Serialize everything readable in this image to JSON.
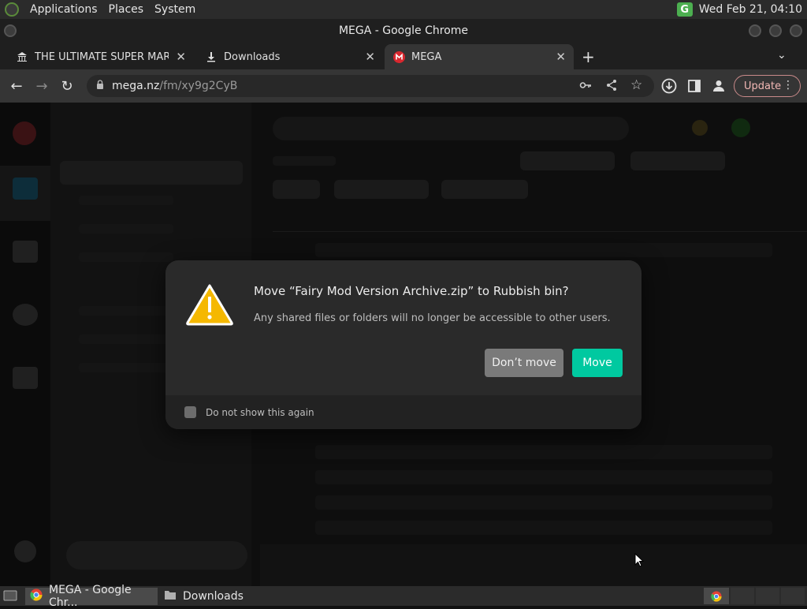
{
  "top_panel": {
    "menus": [
      "Applications",
      "Places",
      "System"
    ],
    "clock": "Wed Feb 21, 04:10",
    "badge": "G"
  },
  "window": {
    "title": "MEGA - Google Chrome"
  },
  "tabs": [
    {
      "label": "THE ULTIMATE SUPER MARIO",
      "icon": "museum-icon"
    },
    {
      "label": "Downloads",
      "icon": "download-icon"
    },
    {
      "label": "MEGA",
      "icon": "mega-logo-icon",
      "active": true
    }
  ],
  "address_bar": {
    "domain": "mega.nz",
    "path": "/fm/xy9g2CyB",
    "update_label": "Update"
  },
  "dialog": {
    "title": "Move “Fairy Mod Version Archive.zip” to Rubbish bin?",
    "message": "Any shared files or folders will no longer be accessible to other users.",
    "cancel_label": "Don’t move",
    "confirm_label": "Move",
    "checkbox_label": "Do not show this again",
    "checkbox_checked": false
  },
  "taskbar": {
    "items": [
      {
        "label": "MEGA - Google Chr...",
        "icon": "chrome-icon",
        "active": true
      },
      {
        "label": "Downloads",
        "icon": "folder-icon",
        "active": false
      }
    ]
  },
  "colors": {
    "accent": "#00c9a0",
    "warning": "#f5b800",
    "update_border": "#c98a8a"
  }
}
